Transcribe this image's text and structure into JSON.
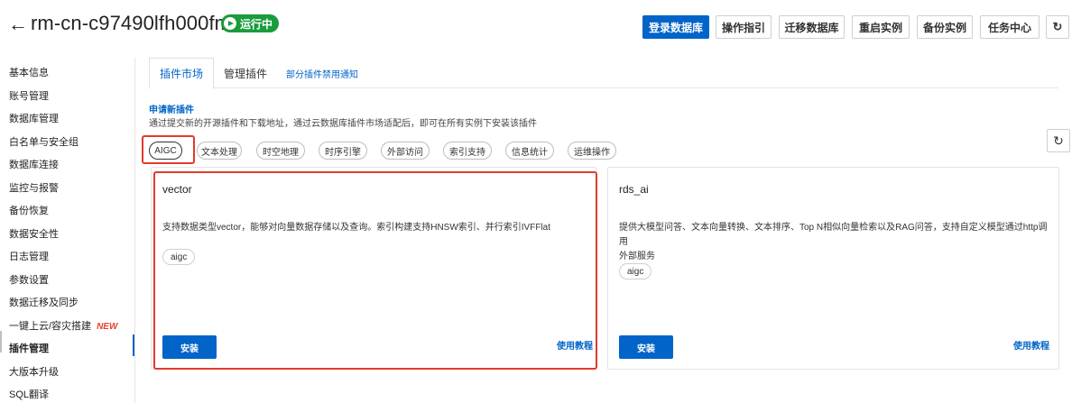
{
  "header": {
    "back_icon": "arrow-left-icon",
    "instance_id": "rm-cn-c97490lfh000fm",
    "status": "运行中",
    "status_color": "#1a9b3c",
    "buttons": {
      "login_db": "登录数据库",
      "guide": "操作指引",
      "migrate_db": "迁移数据库",
      "restart": "重启实例",
      "backup": "备份实例",
      "tasks": "任务中心"
    },
    "refresh_icon": "refresh-icon"
  },
  "sidebar": {
    "items": [
      {
        "label": "基本信息"
      },
      {
        "label": "账号管理"
      },
      {
        "label": "数据库管理"
      },
      {
        "label": "白名单与安全组"
      },
      {
        "label": "数据库连接"
      },
      {
        "label": "监控与报警"
      },
      {
        "label": "备份恢复"
      },
      {
        "label": "数据安全性"
      },
      {
        "label": "日志管理"
      },
      {
        "label": "参数设置"
      },
      {
        "label": "数据迁移及同步"
      },
      {
        "label": "一键上云/容灾搭建",
        "badge": "NEW"
      },
      {
        "label": "插件管理",
        "active": true
      },
      {
        "label": "大版本升级"
      },
      {
        "label": "SQL翻译"
      }
    ]
  },
  "tabs": [
    {
      "label": "插件市场",
      "active": true
    },
    {
      "label": "管理插件"
    },
    {
      "label": "部分插件禁用通知"
    }
  ],
  "apply": {
    "title": "申请新插件",
    "desc": "通过提交新的开源插件和下载地址，通过云数据库插件市场适配后，即可在所有实例下安装该插件"
  },
  "filters": [
    "AIGC",
    "文本处理",
    "时空地理",
    "时序引擎",
    "外部访问",
    "索引支持",
    "信息统计",
    "运维操作"
  ],
  "selected_filter": "AIGC",
  "plugins": [
    {
      "name": "vector",
      "desc": "支持数据类型vector，能够对向量数据存储以及查询。索引构建支持HNSW索引、并行索引IVFFlat",
      "tag": "aigc",
      "install": "安装",
      "tutorial": "使用教程"
    },
    {
      "name": "rds_ai",
      "desc_line1": "提供大模型问答、文本向量转换、文本排序、Top N相似向量检索以及RAG问答，支持自定义模型通过http调用",
      "desc_line2": "外部服务",
      "tag": "aigc",
      "install": "安装",
      "tutorial": "使用教程"
    }
  ],
  "colors": {
    "primary": "#0064c8",
    "highlight": "#e23a2e",
    "new_badge": "#e8402f"
  }
}
